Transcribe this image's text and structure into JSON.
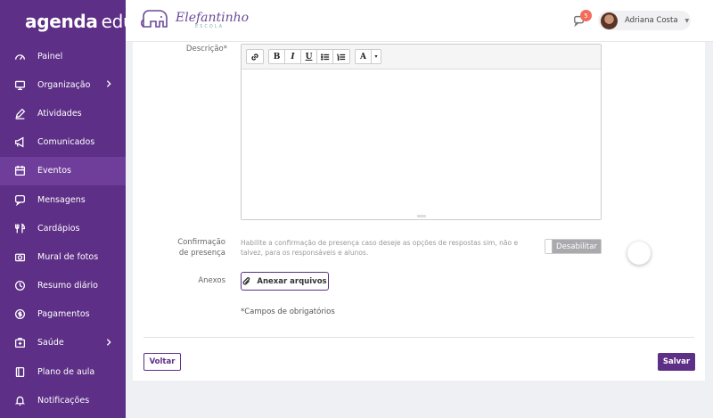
{
  "brand": {
    "part1": "agenda",
    "part2": "edu"
  },
  "sidebar": {
    "items": [
      {
        "label": "Painel",
        "icon": "dashboard-icon"
      },
      {
        "label": "Organização",
        "icon": "monitor-icon",
        "has_arrow": true
      },
      {
        "label": "Atividades",
        "icon": "pencil-icon"
      },
      {
        "label": "Comunicados",
        "icon": "megaphone-icon"
      },
      {
        "label": "Eventos",
        "icon": "calendar-icon",
        "active": true
      },
      {
        "label": "Mensagens",
        "icon": "chat-icon"
      },
      {
        "label": "Cardápios",
        "icon": "utensils-icon"
      },
      {
        "label": "Mural de fotos",
        "icon": "camera-icon"
      },
      {
        "label": "Resumo diário",
        "icon": "clock-icon"
      },
      {
        "label": "Pagamentos",
        "icon": "dollar-icon"
      },
      {
        "label": "Saúde",
        "icon": "medkit-icon",
        "has_arrow": true
      },
      {
        "label": "Plano de aula",
        "icon": "book-icon"
      },
      {
        "label": "Notificações",
        "icon": "bell-icon"
      }
    ]
  },
  "topbar": {
    "school_name": "Elefantinho",
    "school_sub": "ESCOLA",
    "notifications_count": "5",
    "user_name": "Adriana Costa"
  },
  "form": {
    "description_label": "Descrição*",
    "toolbar": {
      "bold": "B",
      "italic": "I",
      "underline": "U",
      "font_color": "A",
      "dropdown": "▾"
    },
    "presence_label_1": "Confirmação",
    "presence_label_2": "de presença",
    "presence_help": "Habilite a confirmação de presença caso deseje as opções de respostas sim, não e talvez, para os responsáveis e alunos.",
    "presence_toggle": "Desabilitar",
    "attachments_label": "Anexos",
    "attach_button": "Anexar arquivos",
    "required_note": "*Campos de obrigatórios",
    "back_button": "Voltar",
    "save_button": "Salvar"
  },
  "colors": {
    "primary": "#5d2f86",
    "active": "#6f3d9a",
    "badge": "#f26b5b"
  }
}
